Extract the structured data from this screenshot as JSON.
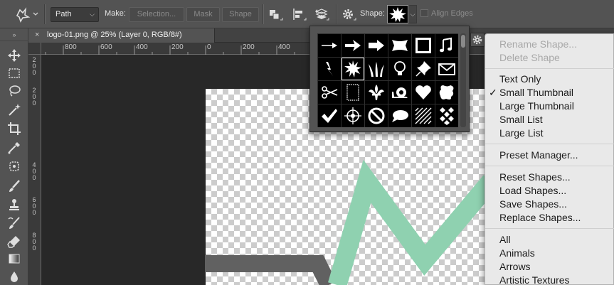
{
  "colors": {
    "chrome": "#535353",
    "pasteboard": "#282828",
    "shape_dark": "#616161",
    "shape_green": "#8fd1b0",
    "menu_bg": "#e9e9e9"
  },
  "options_bar": {
    "tool_icon": "custom-shape-tool-icon",
    "mode": "Path",
    "make_label": "Make:",
    "selection_button": "Selection...",
    "mask_button": "Mask",
    "shape_button": "Shape",
    "shape_label": "Shape:",
    "align_edges_label": "Align Edges"
  },
  "document": {
    "tab_title": "logo-01.png @ 25% (Layer 0, RGB/8#)",
    "close_glyph": "×"
  },
  "ruler": {
    "top_labels": [
      "800",
      "600",
      "400",
      "200",
      "0",
      "200",
      "400"
    ],
    "left_labels": [
      "2",
      "0",
      "0",
      "2",
      "0",
      "0",
      "4",
      "0",
      "0",
      "6",
      "0",
      "0",
      "8",
      "0",
      "0"
    ]
  },
  "shape_picker": {
    "selected": "starburst",
    "shapes": [
      "arrow-thin",
      "arrow-bold",
      "arrow-block",
      "banner",
      "frame-rough",
      "music-notes",
      "lightning",
      "starburst",
      "grass",
      "lightbulb",
      "pushpin",
      "envelope",
      "scissors",
      "stamp-frame",
      "fleur-de-lis",
      "snail",
      "heart",
      "blob",
      "checkmark",
      "crosshair",
      "no-symbol",
      "speech-bubble",
      "diagonal-grid",
      "checkerboard"
    ]
  },
  "menu": {
    "items": [
      {
        "label": "Rename Shape...",
        "enabled": false,
        "checked": false
      },
      {
        "label": "Delete Shape",
        "enabled": false,
        "checked": false
      },
      {
        "label": "Text Only",
        "enabled": true,
        "checked": false
      },
      {
        "label": "Small Thumbnail",
        "enabled": true,
        "checked": true
      },
      {
        "label": "Large Thumbnail",
        "enabled": true,
        "checked": false
      },
      {
        "label": "Small List",
        "enabled": true,
        "checked": false
      },
      {
        "label": "Large List",
        "enabled": true,
        "checked": false
      },
      {
        "label": "Preset Manager...",
        "enabled": true,
        "checked": false
      },
      {
        "label": "Reset Shapes...",
        "enabled": true,
        "checked": false
      },
      {
        "label": "Load Shapes...",
        "enabled": true,
        "checked": false
      },
      {
        "label": "Save Shapes...",
        "enabled": true,
        "checked": false
      },
      {
        "label": "Replace Shapes...",
        "enabled": true,
        "checked": false
      },
      {
        "label": "All",
        "enabled": true,
        "checked": false
      },
      {
        "label": "Animals",
        "enabled": true,
        "checked": false
      },
      {
        "label": "Arrows",
        "enabled": true,
        "checked": false
      },
      {
        "label": "Artistic Textures",
        "enabled": true,
        "checked": false
      }
    ],
    "check_glyph": "✓"
  }
}
